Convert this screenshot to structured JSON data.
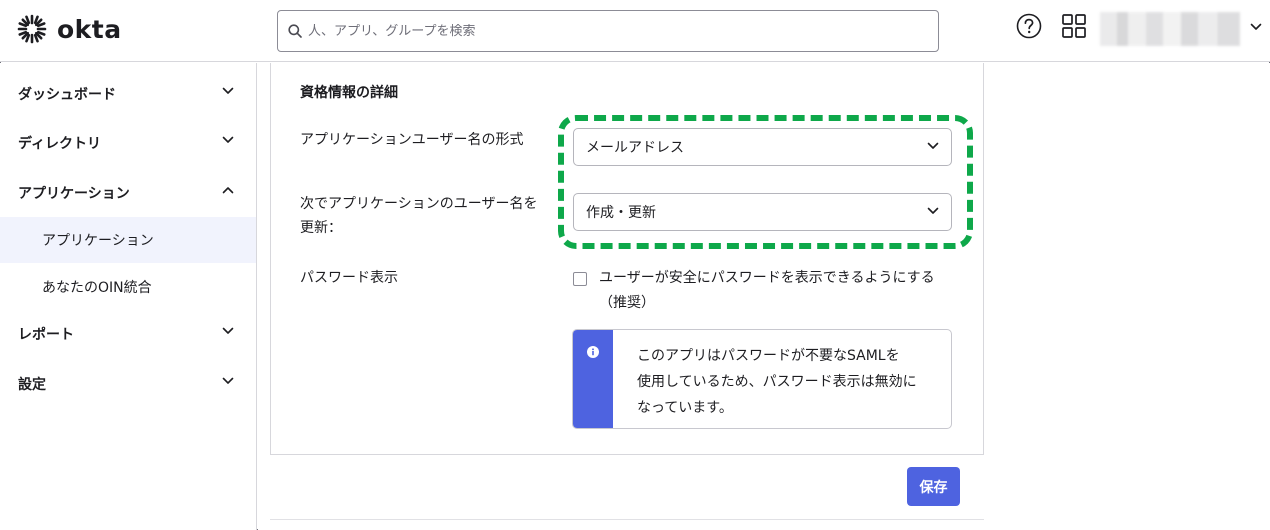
{
  "header": {
    "logo_text": "okta",
    "search_placeholder": "人、アプリ、グループを検索"
  },
  "sidebar": {
    "items": [
      {
        "label": "ダッシュボード"
      },
      {
        "label": "ディレクトリ"
      },
      {
        "label": "アプリケーション"
      },
      {
        "label": "アプリケーション"
      },
      {
        "label": "あなたのOIN統合"
      },
      {
        "label": "レポート"
      },
      {
        "label": "設定"
      }
    ]
  },
  "main": {
    "section_title": "資格情報の詳細",
    "username_format_label": "アプリケーションユーザー名の形式",
    "username_format_value": "メールアドレス",
    "update_label_line1": "次でアプリケーションのユーザー名を",
    "update_label_line2": "更新：",
    "update_value": "作成・更新",
    "password_reveal_label": "パスワード表示",
    "password_reveal_checkbox_line1": "ユーザーが安全にパスワードを表示できるようにする",
    "password_reveal_checkbox_line2": "（推奨）",
    "callout_line1": "このアプリはパスワードが不要なSAMLを",
    "callout_line2": "使用しているため、パスワード表示は無効に",
    "callout_line3": "なっています。",
    "save_label": "保存"
  },
  "colors": {
    "accent": "#4e63e0",
    "highlight": "#0ea84a",
    "active_nav_bg": "#f1f3fd"
  },
  "icons": {
    "logo": "okta-sunburst-icon",
    "search": "search-icon",
    "help": "help-icon",
    "apps": "app-grid-icon",
    "chevron": "chevron-down-icon",
    "info": "info-icon"
  }
}
